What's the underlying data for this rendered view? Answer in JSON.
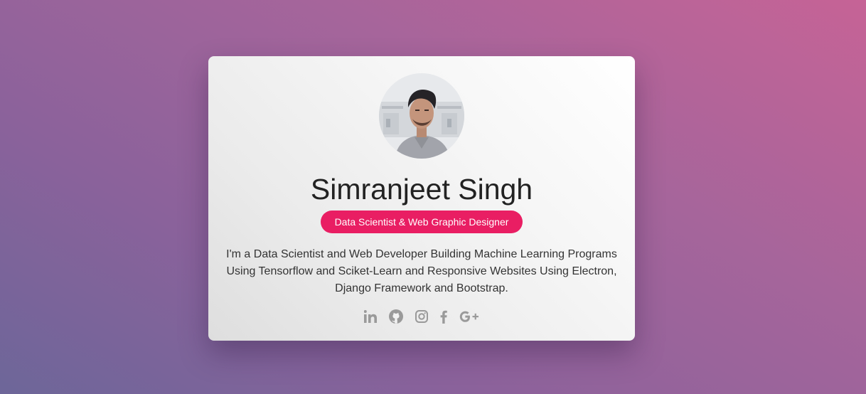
{
  "profile": {
    "name": "Simranjeet Singh",
    "role": "Data Scientist & Web Graphic Designer",
    "bio": "I'm a Data Scientist and Web Developer Building Machine Learning Programs Using Tensorflow and Sciket-Learn and Responsive Websites Using Electron, Django Framework and Bootstrap.",
    "avatar_alt": "profile photo"
  },
  "social_links": [
    {
      "icon": "linkedin-icon"
    },
    {
      "icon": "github-icon"
    },
    {
      "icon": "instagram-icon"
    },
    {
      "icon": "facebook-icon"
    },
    {
      "icon": "google-plus-icon"
    }
  ],
  "colors": {
    "badge": "#e91e63",
    "icon": "#9a9a9a",
    "background_start": "#6d6699",
    "background_end": "#c66396"
  }
}
